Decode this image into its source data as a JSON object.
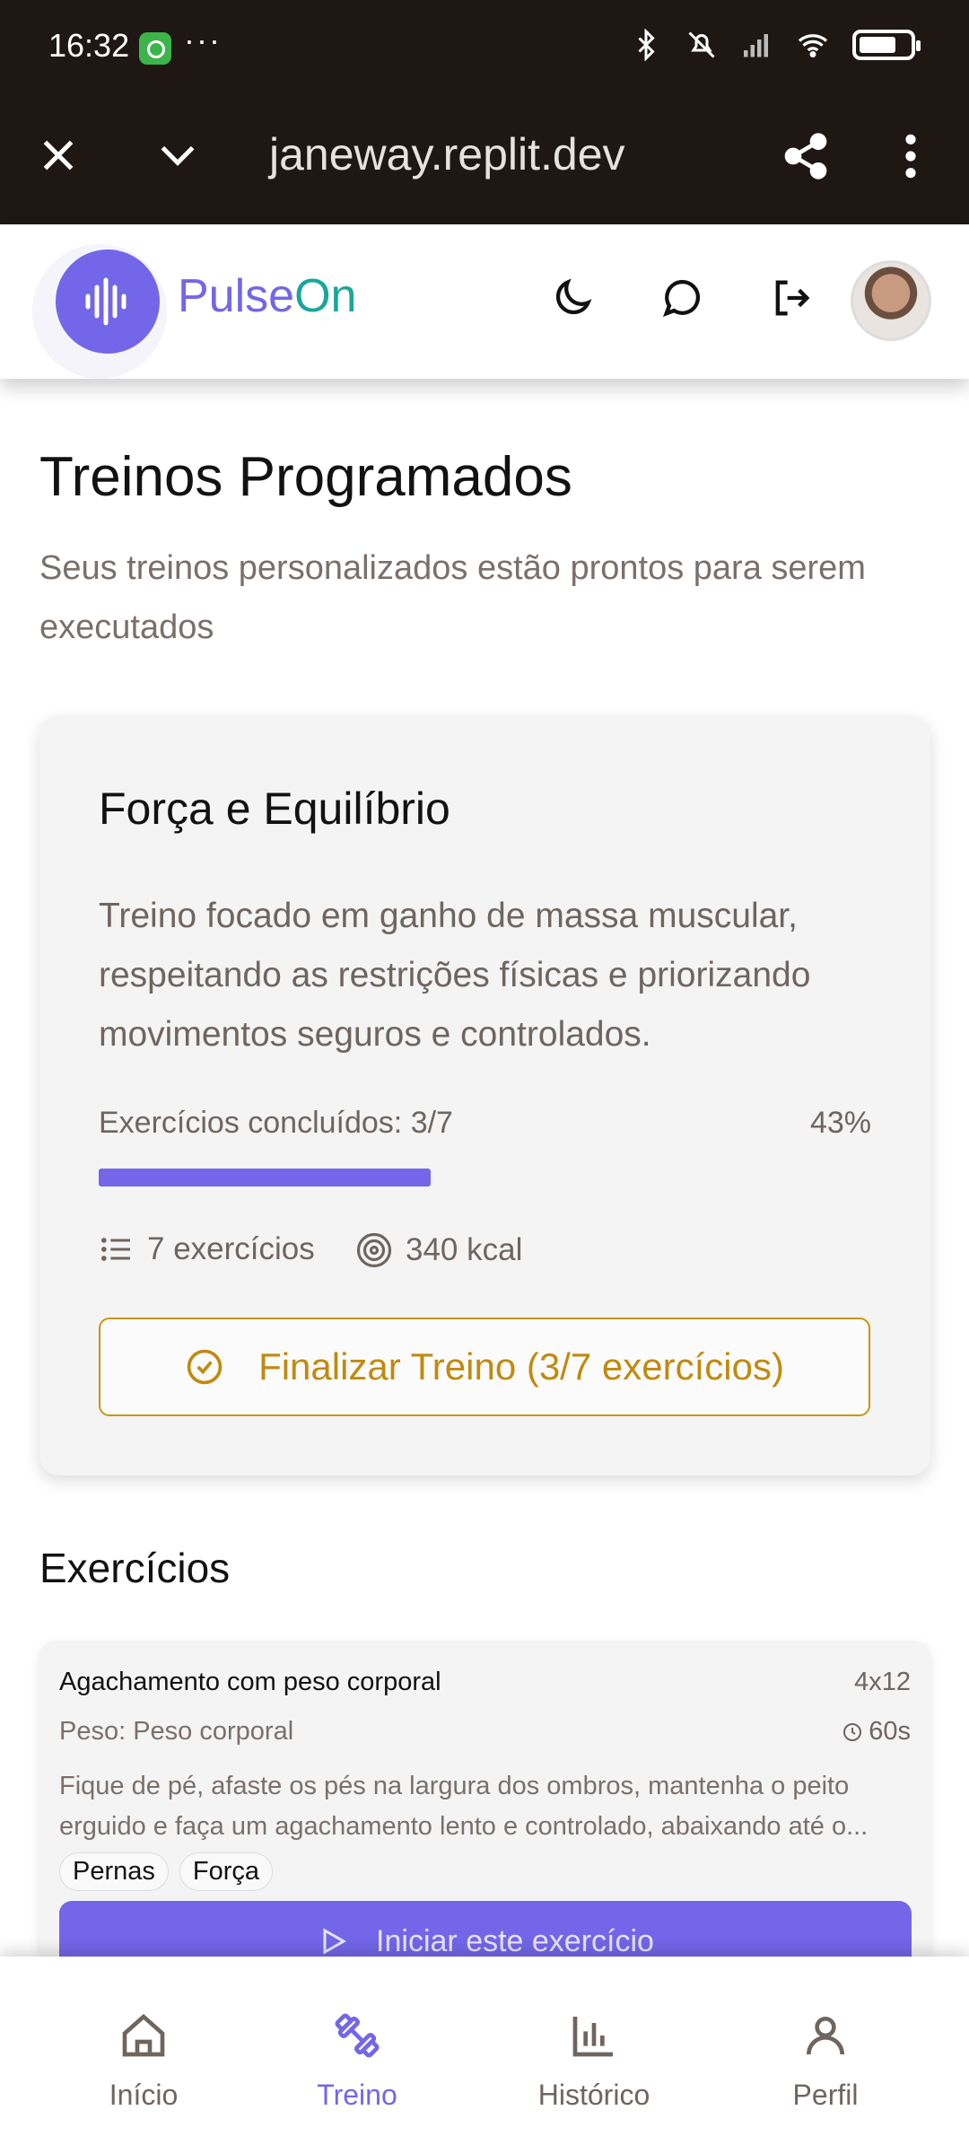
{
  "status_bar": {
    "time": "16:32",
    "notification_dots": "···",
    "icons": [
      "whatsapp-icon",
      "bluetooth-icon",
      "mute-icon",
      "signal-icon",
      "wifi-icon",
      "battery-icon"
    ]
  },
  "browser": {
    "url": "janeway.replit.dev",
    "close_icon": "close-icon",
    "collapse_icon": "chevron-down-icon",
    "share_icon": "share-icon",
    "menu_icon": "more-vertical-icon"
  },
  "app_header": {
    "brand_part1": "Pulse",
    "brand_part2": "On",
    "icons": [
      "moon-icon",
      "chat-icon",
      "logout-icon"
    ],
    "avatar_alt": "user avatar"
  },
  "page": {
    "title": "Treinos Programados",
    "subtitle": "Seus treinos personalizados estão prontos para serem executados"
  },
  "workout": {
    "title": "Força e Equilíbrio",
    "description": "Treino focado em ganho de massa muscular, respeitando as restrições físicas e priorizando movimentos seguros e controlados.",
    "progress_label": "Exercícios concluídos: 3/7",
    "progress_percent_text": "43%",
    "progress_value": 0.43,
    "exercise_count": "7 exercícios",
    "calories": "340 kcal",
    "finish_button": "Finalizar Treino (3/7 exercícios)",
    "colors": {
      "accent": "#7366e8",
      "warning": "#c08a10"
    }
  },
  "exercises_section": {
    "title": "Exercícios",
    "items": [
      {
        "name": "Agachamento com peso corporal",
        "sets": "4x12",
        "weight": "Peso: Peso corporal",
        "rest": "60s",
        "description": "Fique de pé, afaste os pés na largura dos ombros, mantenha o peito erguido e faça um agachamento lento e controlado, abaixando até o...",
        "tags": [
          "Pernas",
          "Força"
        ],
        "start_button": "Iniciar este exercício"
      }
    ]
  },
  "bottom_nav": {
    "items": [
      {
        "label": "Início",
        "icon": "home-icon",
        "active": false
      },
      {
        "label": "Treino",
        "icon": "dumbbell-icon",
        "active": true
      },
      {
        "label": "Histórico",
        "icon": "bar-chart-icon",
        "active": false
      },
      {
        "label": "Perfil",
        "icon": "user-icon",
        "active": false
      }
    ]
  }
}
